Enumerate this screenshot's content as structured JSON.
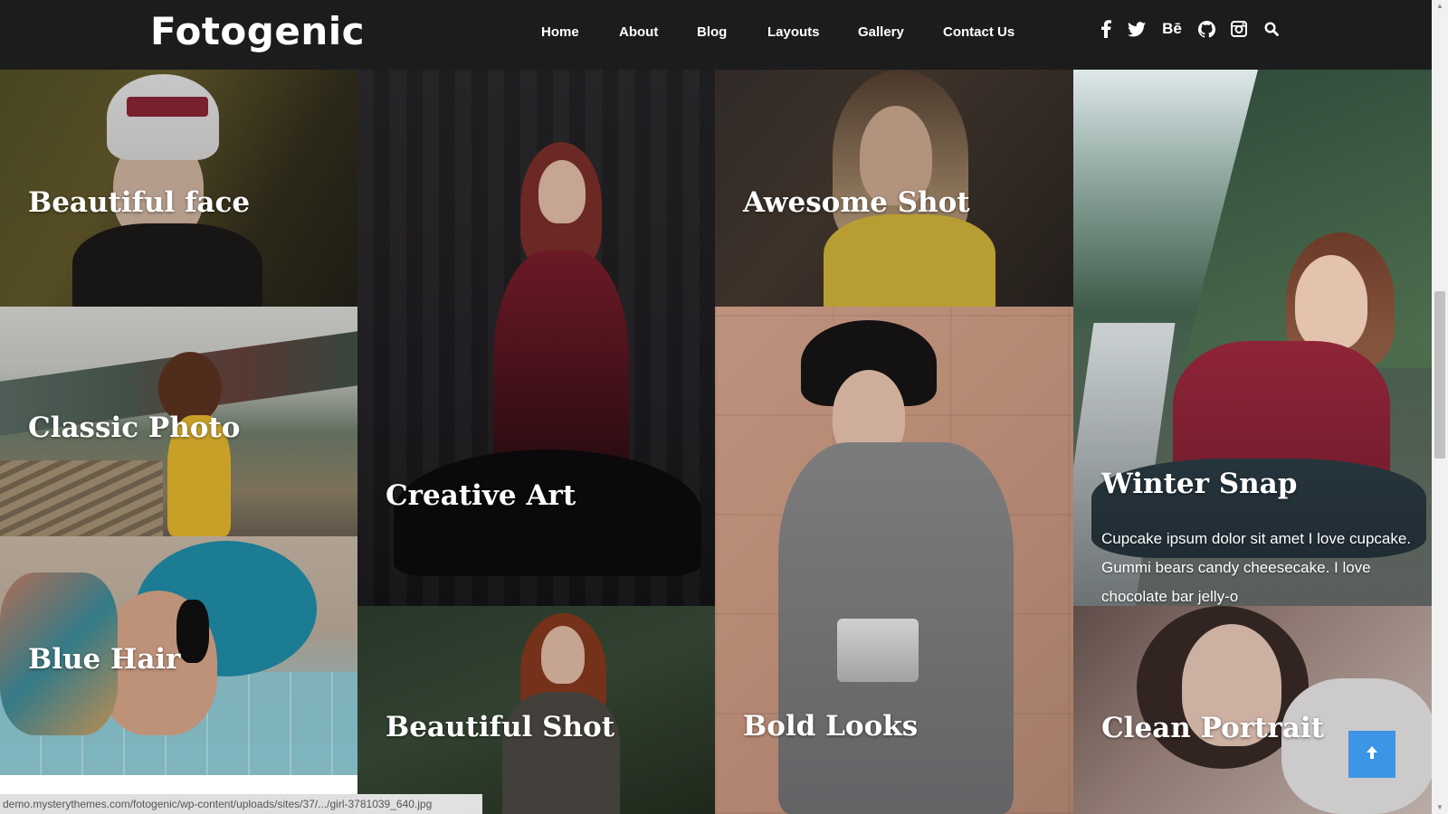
{
  "site": {
    "logo": "Fotogenic"
  },
  "nav": {
    "items": [
      {
        "label": "Home",
        "name": "nav-home"
      },
      {
        "label": "About",
        "name": "nav-about"
      },
      {
        "label": "Blog",
        "name": "nav-blog"
      },
      {
        "label": "Layouts",
        "name": "nav-layouts"
      },
      {
        "label": "Gallery",
        "name": "nav-gallery"
      },
      {
        "label": "Contact Us",
        "name": "nav-contact-us"
      }
    ]
  },
  "social": {
    "icons": [
      "facebook-icon",
      "twitter-icon",
      "behance-icon",
      "github-icon",
      "instagram-icon",
      "search-icon"
    ],
    "behance_glyph": "Bē"
  },
  "gallery": {
    "tiles": [
      {
        "title": "Beautiful face"
      },
      {
        "title": "Creative Art"
      },
      {
        "title": "Awesome Shot"
      },
      {
        "title": "Winter Snap",
        "excerpt": "Cupcake ipsum dolor sit amet I love cupcake. Gummi bears candy cheesecake. I love chocolate bar jelly-o"
      },
      {
        "title": "Classic Photo"
      },
      {
        "title": "Bold Looks"
      },
      {
        "title": "Blue Hair"
      },
      {
        "title": "Beautiful Shot"
      },
      {
        "title": "Clean Portrait"
      }
    ]
  },
  "status_bar": {
    "url": "demo.mysterythemes.com/fotogenic/wp-content/uploads/sites/37/.../girl-3781039_640.jpg"
  },
  "colors": {
    "header_bg": "#1c1c1c",
    "accent": "#3d95e5",
    "text": "#ffffff"
  },
  "back_to_top": {
    "icon": "arrow-up-icon"
  }
}
